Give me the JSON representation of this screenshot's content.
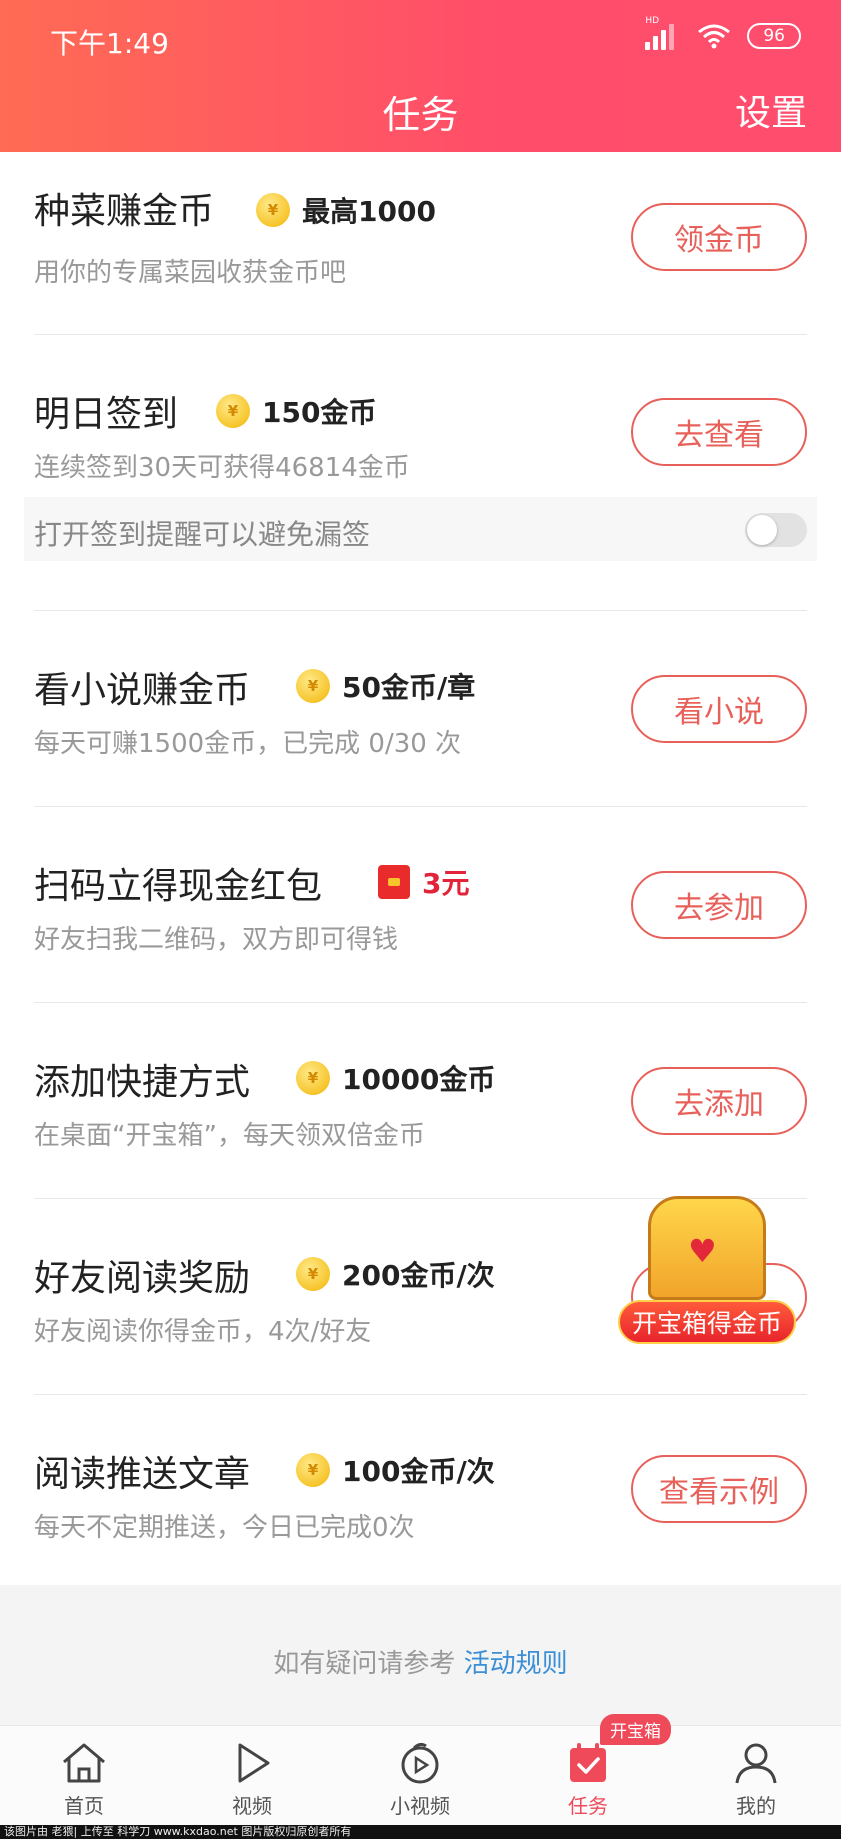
{
  "status": {
    "time": "下午1:49",
    "network": "HD",
    "battery": "96"
  },
  "header": {
    "title": "任务",
    "settings": "设置"
  },
  "tasks": [
    {
      "name": "种菜赚金币",
      "reward_icon": "coin-icon",
      "reward": "最高1000",
      "desc": "用你的专属菜园收获金币吧",
      "button": "领金币"
    },
    {
      "name": "明日签到",
      "reward_icon": "coin-icon",
      "reward": "150金币",
      "desc": "连续签到30天可获得46814金币",
      "button": "去查看"
    },
    {
      "name": "看小说赚金币",
      "reward_icon": "coin-icon",
      "reward": "50金币/章",
      "desc": "每天可赚1500金币，已完成 0/30 次",
      "button": "看小说"
    },
    {
      "name": "扫码立得现金红包",
      "reward_icon": "red-packet-icon",
      "reward": "3元",
      "desc": "好友扫我二维码，双方即可得钱",
      "button": "去参加"
    },
    {
      "name": "添加快捷方式",
      "reward_icon": "coin-icon",
      "reward": "10000金币",
      "desc": "在桌面“开宝箱”，每天领双倍金币",
      "button": "去添加"
    },
    {
      "name": "好友阅读奖励",
      "reward_icon": "coin-icon",
      "reward": "200金币/次",
      "desc": "好友阅读你得金币，4次/好友",
      "button": ""
    },
    {
      "name": "阅读推送文章",
      "reward_icon": "coin-icon",
      "reward": "100金币/次",
      "desc": "每天不定期推送，今日已完成0次",
      "button": "查看示例"
    }
  ],
  "reminder": {
    "text": "打开签到提醒可以避免漏签",
    "toggle_on": false
  },
  "treasure_chest": {
    "label": "开宝箱得金币"
  },
  "footer": {
    "note": "如有疑问请参考",
    "link": "活动规则"
  },
  "tabbar": {
    "tabs": [
      {
        "label": "首页",
        "icon": "home-icon"
      },
      {
        "label": "视频",
        "icon": "play-icon"
      },
      {
        "label": "小视频",
        "icon": "short-video-icon"
      },
      {
        "label": "任务",
        "icon": "task-calendar-icon",
        "badge": "开宝箱",
        "active": true
      },
      {
        "label": "我的",
        "icon": "profile-icon"
      }
    ]
  },
  "watermark": "该图片由 老猥| 上传至 科学刀 www.kxdao.net 图片版权归原创者所有",
  "colors": {
    "header_start": "#ff6b54",
    "header_end": "#ff4d6e",
    "accent": "#ef4a5a",
    "link": "#3c8fd6"
  }
}
